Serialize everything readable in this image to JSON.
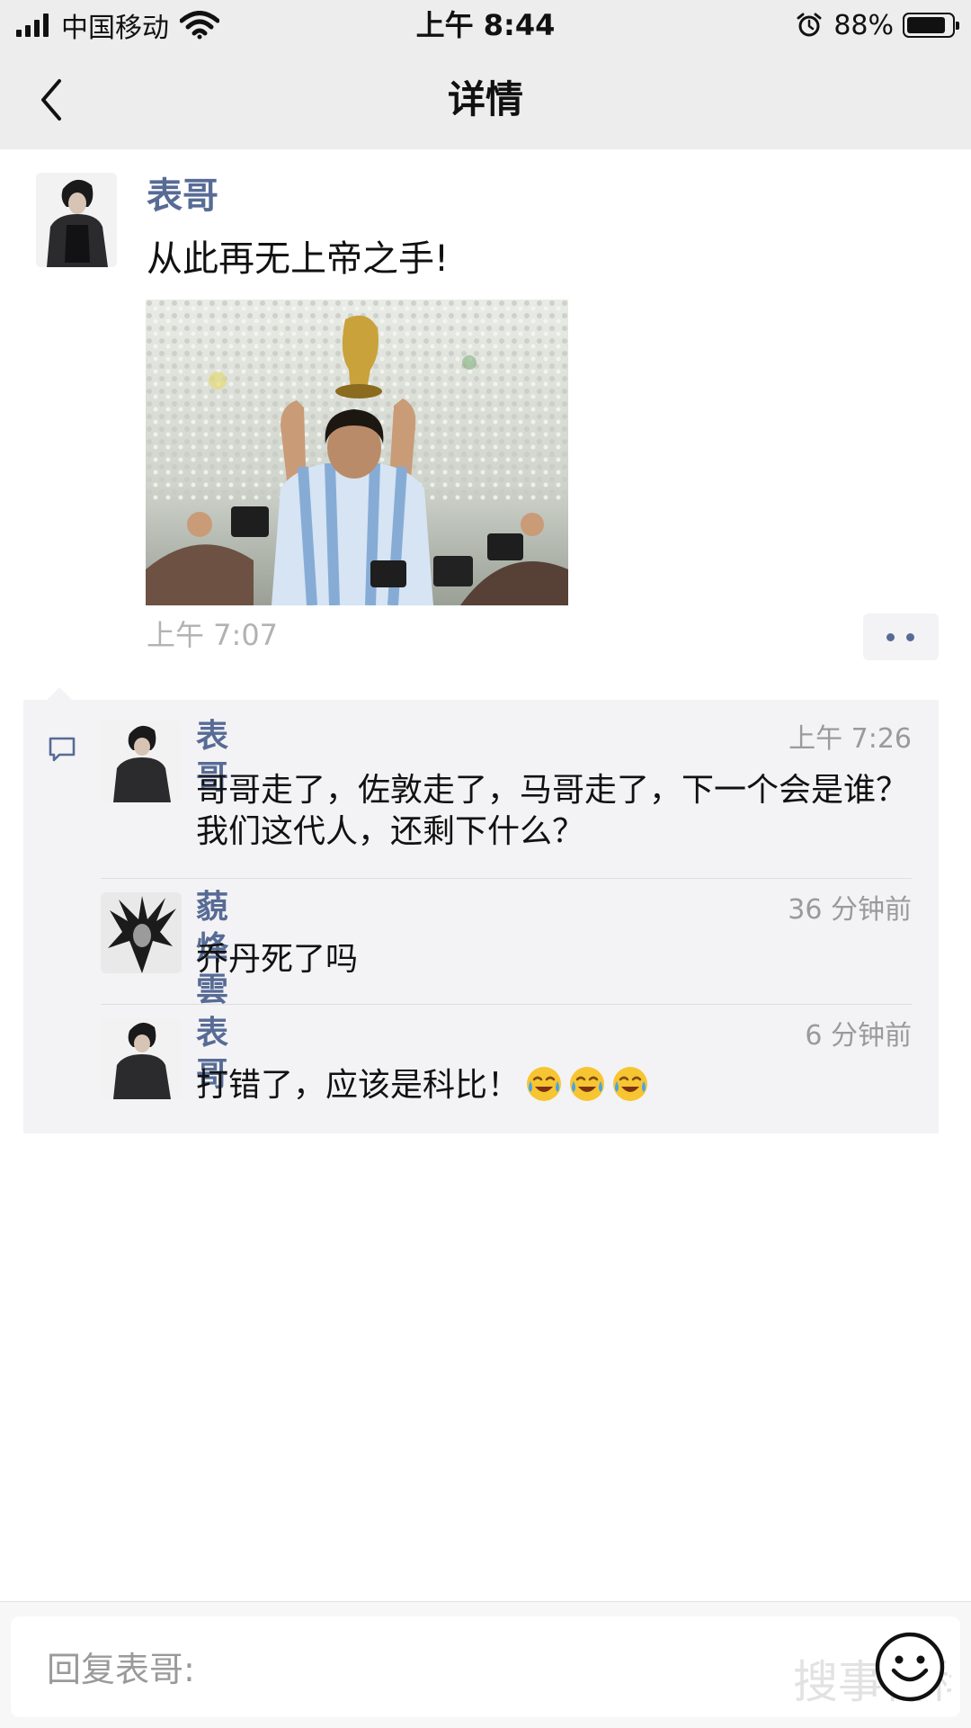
{
  "status_bar": {
    "carrier": "中国移动",
    "time": "上午 8:44",
    "battery_percent_text": "88%",
    "battery_level": 0.88,
    "icons": [
      "signal-icon",
      "wifi-icon",
      "alarm-icon",
      "battery-icon"
    ]
  },
  "navbar": {
    "back_icon": "chevron-left-icon",
    "title": "详情"
  },
  "post": {
    "author": "表哥",
    "text": "从此再无上帝之手!",
    "time": "上午 7:07",
    "more_icon": "two-dots-icon"
  },
  "comments": [
    {
      "author": "表哥",
      "time": "上午 7:26",
      "text": "哥哥走了，佐敦走了，马哥走了，下一个会是谁？我们这代人，还剩下什么？"
    },
    {
      "author": "藐烽雲",
      "time": "36 分钟前",
      "text": "乔丹死了吗"
    },
    {
      "author": "表哥",
      "time": "6 分钟前",
      "text": "打错了，应该是科比！",
      "emojis": [
        "crying-laughing-emoji",
        "crying-laughing-emoji",
        "crying-laughing-emoji"
      ]
    }
  ],
  "reply": {
    "placeholder": "回复表哥:",
    "emoji_button_icon": "smiley-face-icon"
  },
  "watermark": "搜事百科",
  "colors": {
    "link_blue": "#576b95",
    "bar_gray": "#ededed",
    "comment_bg": "#f3f3f5",
    "muted_text": "#b2b2b2"
  }
}
